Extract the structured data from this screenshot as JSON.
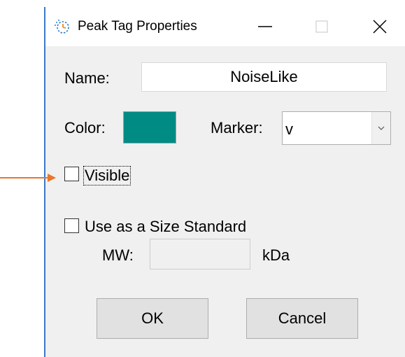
{
  "window": {
    "title": "Peak Tag Properties",
    "accent_border_color": "#3a78c9"
  },
  "titlebar_buttons": {
    "minimize_icon": "minimize-icon",
    "maximize_icon": "maximize-icon",
    "close_icon": "close-icon"
  },
  "form": {
    "name_label": "Name:",
    "name_value": "NoiseLike",
    "color_label": "Color:",
    "color_value": "#008b84",
    "marker_label": "Marker:",
    "marker_value": "v",
    "visible_label": "Visible",
    "visible_checked": false,
    "size_standard_label": "Use as a Size Standard",
    "size_standard_checked": false,
    "mw_label": "MW:",
    "mw_value": "",
    "mw_unit": "kDa"
  },
  "buttons": {
    "ok": "OK",
    "cancel": "Cancel"
  },
  "annotation": {
    "arrow_color": "#e8762b"
  }
}
